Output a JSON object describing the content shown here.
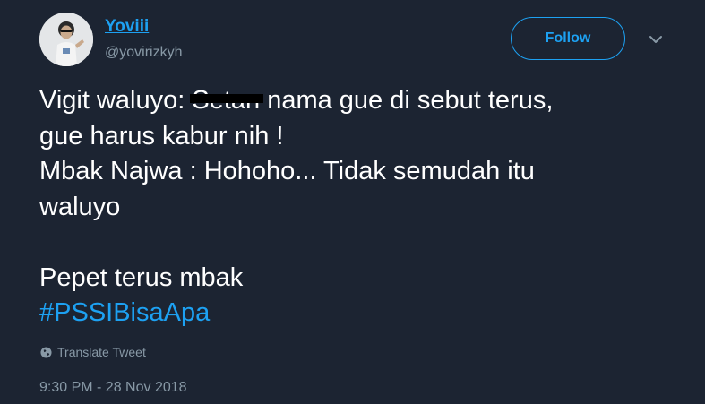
{
  "user": {
    "display_name": "Yoviii",
    "handle": "@yovirizkyh",
    "avatar": "profile-photo"
  },
  "header": {
    "follow_label": "Follow",
    "menu_icon": "chevron-down-icon"
  },
  "tweet": {
    "line1_prefix": "Vigit waluyo: ",
    "line1_redacted": "Setan",
    "line1_suffix": " nama gue di sebut terus,",
    "line2": "gue harus kabur nih !",
    "line3": "Mbak Najwa : Hohoho... Tidak semudah itu",
    "line4": "waluyo",
    "line5": "Pepet terus mbak",
    "hashtag": "#PSSIBisaApa"
  },
  "translate": {
    "icon": "globe-icon",
    "label": "Translate Tweet"
  },
  "meta": {
    "timestamp": "9:30 PM - 28 Nov 2018"
  },
  "colors": {
    "background": "#1c2432",
    "accent": "#1da1f2",
    "text": "#ffffff",
    "muted": "#8899a6"
  }
}
